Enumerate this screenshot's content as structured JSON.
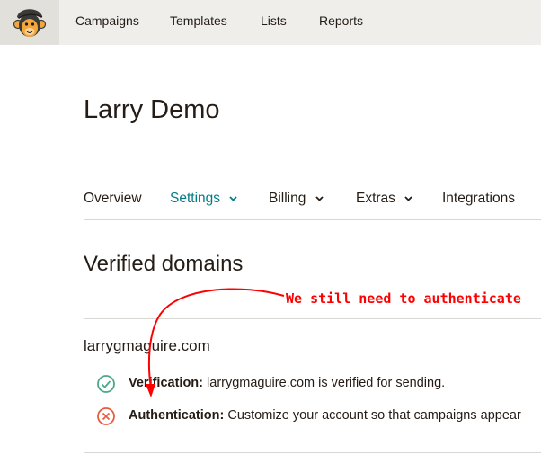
{
  "topnav": {
    "items": [
      {
        "label": "Campaigns"
      },
      {
        "label": "Templates"
      },
      {
        "label": "Lists"
      },
      {
        "label": "Reports"
      }
    ]
  },
  "account": {
    "title": "Larry Demo"
  },
  "tabs": [
    {
      "label": "Overview",
      "has_dropdown": false,
      "active": false
    },
    {
      "label": "Settings",
      "has_dropdown": true,
      "active": true
    },
    {
      "label": "Billing",
      "has_dropdown": true,
      "active": false
    },
    {
      "label": "Extras",
      "has_dropdown": true,
      "active": false
    },
    {
      "label": "Integrations",
      "has_dropdown": false,
      "active": false
    }
  ],
  "verified_domains": {
    "title": "Verified domains",
    "domain": "larrygmaguire.com",
    "verification": {
      "label": "Verification:",
      "text": "larrygmaguire.com is verified for sending.",
      "status": "verified"
    },
    "authentication": {
      "label": "Authentication:",
      "text": "Customize your account so that campaigns appear",
      "status": "not-authenticated"
    }
  },
  "annotation": {
    "text": "We still need to authenticate",
    "color": "#ff0000"
  },
  "colors": {
    "accent": "#007c89",
    "success": "#4ca88a",
    "error": "#e85c41",
    "topbar": "#efeeea"
  }
}
